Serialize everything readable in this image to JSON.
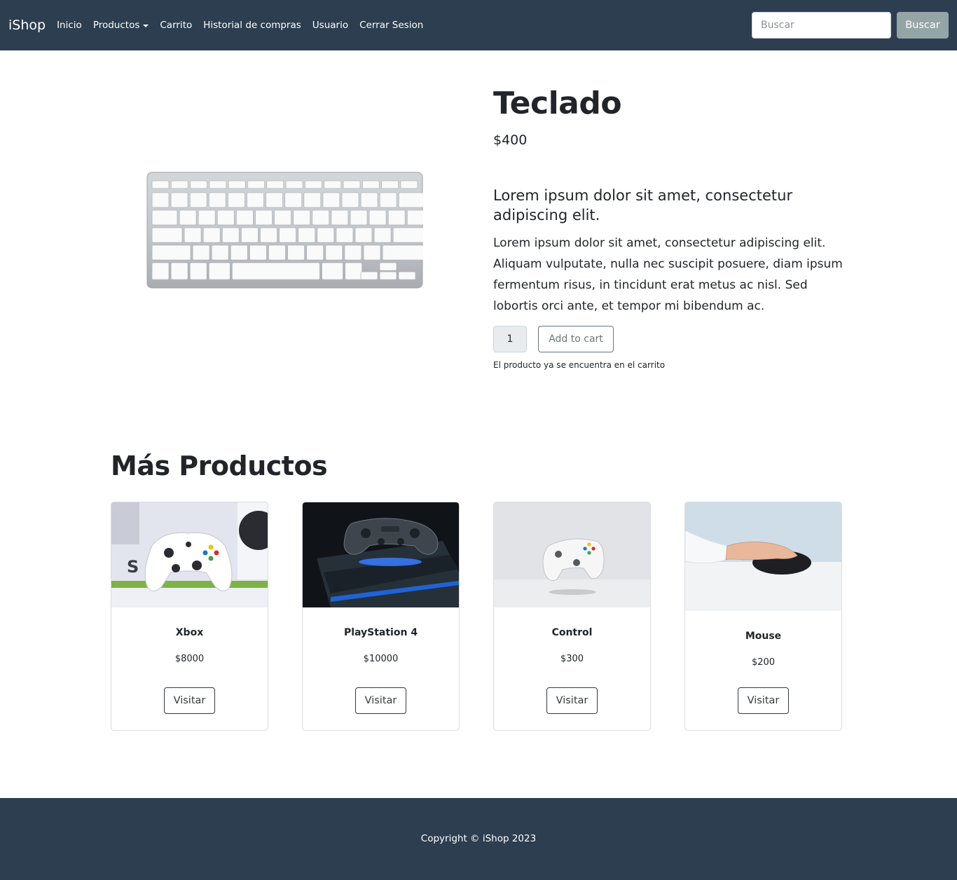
{
  "navbar": {
    "brand": "iShop",
    "links": {
      "inicio": "Inicio",
      "productos": "Productos",
      "carrito": "Carrito",
      "historial": "Historial de compras",
      "usuario": "Usuario",
      "cerrar_sesion": "Cerrar Sesion"
    },
    "search": {
      "placeholder": "Buscar",
      "button_label": "Buscar"
    },
    "background_color": "#2c3e50"
  },
  "product": {
    "title": "Teclado",
    "price": "$400",
    "lead": "Lorem ipsum dolor sit amet, consectetur adipiscing elit.",
    "description": "Lorem ipsum dolor sit amet, consectetur adipiscing elit. Aliquam vulputate, nulla nec suscipit posuere, diam ipsum fermentum risus, in tincidunt erat metus ac nisl. Sed lobortis orci ante, et tempor mi bibendum ac.",
    "quantity": "1",
    "add_to_cart_label": "Add to cart",
    "cart_note": "El producto ya se encuentra en el carrito"
  },
  "more_products": {
    "title": "Más Productos",
    "items": [
      {
        "name": "Xbox",
        "price": "$8000",
        "button_label": "Visitar"
      },
      {
        "name": "PlayStation 4",
        "price": "$10000",
        "button_label": "Visitar"
      },
      {
        "name": "Control",
        "price": "$300",
        "button_label": "Visitar"
      },
      {
        "name": "Mouse",
        "price": "$200",
        "button_label": "Visitar"
      }
    ]
  },
  "footer": {
    "copyright": "Copyright © iShop 2023"
  }
}
